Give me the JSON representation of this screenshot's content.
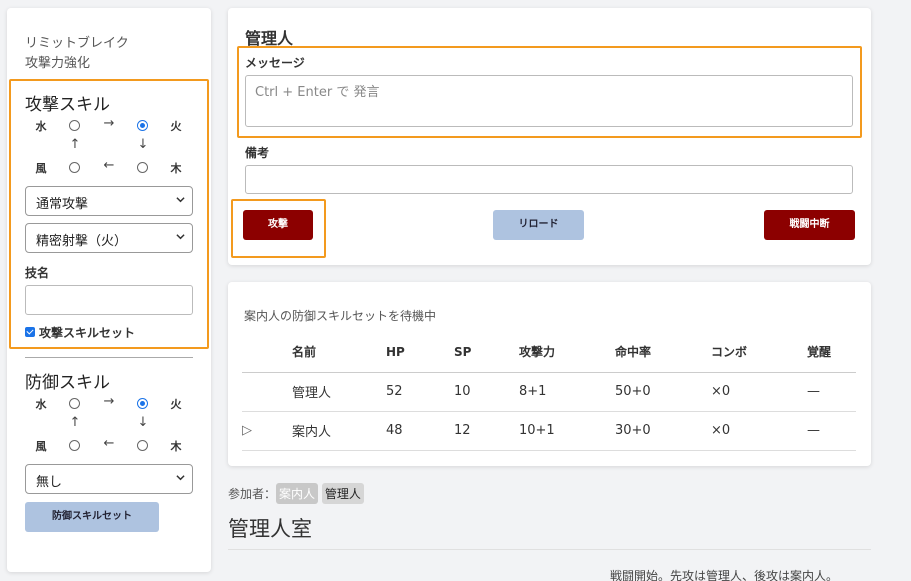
{
  "sidebar": {
    "status_line1": "リミットブレイク",
    "status_line2": "攻撃力強化",
    "attack": {
      "title": "攻撃スキル",
      "cycle": {
        "water": "水",
        "fire": "火",
        "wind": "風",
        "wood": "木"
      },
      "arrows": {
        "right": "→",
        "down": "↓",
        "left": "←",
        "up": "↑"
      },
      "select1": "通常攻撃",
      "select2": "精密射撃（火）",
      "skill_name_label": "技名",
      "skill_name_value": "",
      "checkbox_label": "攻撃スキルセット"
    },
    "defense": {
      "title": "防御スキル",
      "cycle": {
        "water": "水",
        "fire": "火",
        "wind": "風",
        "wood": "木"
      },
      "arrows": {
        "right": "→",
        "down": "↓",
        "left": "←",
        "up": "↑"
      },
      "select": "無し",
      "set_button": "防御スキルセット"
    }
  },
  "main": {
    "title": "管理人",
    "message_label": "メッセージ",
    "message_placeholder": "Ctrl + Enter で 発言",
    "note_label": "備考",
    "attack_button": "攻撃",
    "reload_button": "リロード",
    "stop_button": "戦闘中断"
  },
  "battle": {
    "status": "案内人の防御スキルセットを待機中",
    "columns": [
      "",
      "名前",
      "HP",
      "SP",
      "攻撃力",
      "命中率",
      "コンボ",
      "覚醒"
    ],
    "rows": [
      [
        "",
        "管理人",
        "52",
        "10",
        "8+1",
        "50+0",
        "×0",
        "—"
      ],
      [
        "▷",
        "案内人",
        "48",
        "12",
        "10+1",
        "30+0",
        "×0",
        "—"
      ]
    ]
  },
  "participants": {
    "label": "参加者：",
    "names": [
      "案内人",
      "管理人"
    ]
  },
  "room": {
    "title": "管理人室",
    "log": "戦闘開始。先攻は管理人、後攻は案内人。"
  },
  "colors": {
    "highlight": "#f39a1e",
    "danger_button": "#8c0000",
    "secondary_button": "#aec3e0",
    "radio_selected": "#1a73e8"
  }
}
